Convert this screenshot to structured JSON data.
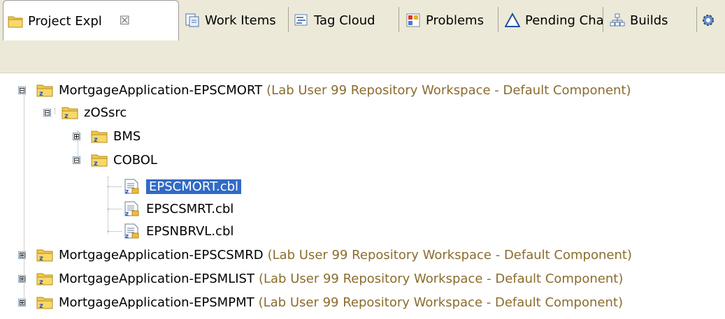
{
  "tabs": [
    {
      "label": "Project Expl",
      "icon": "folder-project-icon",
      "active": true
    },
    {
      "label": "Work Items",
      "icon": "work-items-icon"
    },
    {
      "label": "Tag Cloud",
      "icon": "tag-cloud-icon"
    },
    {
      "label": "Problems",
      "icon": "problems-icon"
    },
    {
      "label": "Pending Cha",
      "icon": "triangle-icon"
    },
    {
      "label": "Builds",
      "icon": "builds-icon"
    }
  ],
  "tab_close_glyph": "☒",
  "tree": [
    {
      "label": "MortgageApplication-EPSCMORT",
      "suffix": "(Lab User 99 Repository Workspace - Default Component)",
      "expand": "⊟"
    },
    {
      "label": "zOSsrc",
      "expand": "⊟"
    },
    {
      "label": "BMS",
      "expand": "⊞"
    },
    {
      "label": "COBOL",
      "expand": "⊟"
    },
    {
      "label": "EPSCMORT.cbl",
      "selected": true
    },
    {
      "label": "EPSCSMRT.cbl"
    },
    {
      "label": "EPSNBRVL.cbl"
    },
    {
      "label": "MortgageApplication-EPSCSMRD",
      "suffix": "(Lab User 99 Repository Workspace - Default Component)",
      "expand": "⊞"
    },
    {
      "label": "MortgageApplication-EPSMLIST",
      "suffix": "(Lab User 99 Repository Workspace - Default Component)",
      "expand": "⊞"
    },
    {
      "label": "MortgageApplication-EPSMPMT",
      "suffix": "(Lab User 99 Repository Workspace - Default Component)",
      "expand": "⊞"
    }
  ],
  "colors": {
    "selection": "#316ac5",
    "decoration": "#8b6c2c",
    "tabbar": "#ece9d8"
  }
}
